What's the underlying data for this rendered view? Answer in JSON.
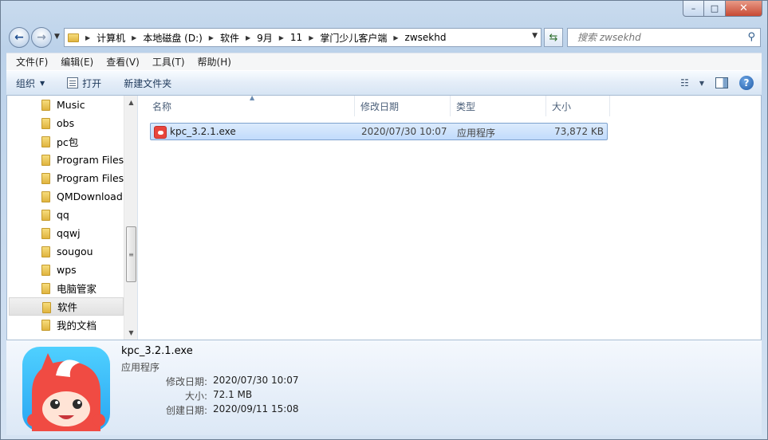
{
  "window_controls": {
    "minimize": "–",
    "maximize": "□",
    "close": "✕"
  },
  "nav": {
    "back_icon": "back-arrow-icon",
    "forward_icon": "forward-arrow-icon",
    "breadcrumbs": [
      "计算机",
      "本地磁盘 (D:)",
      "软件",
      "9月",
      "11",
      "掌门少儿客户端",
      "zwsekhd"
    ],
    "search_placeholder": "搜索 zwsekhd"
  },
  "menu": [
    "文件(F)",
    "编辑(E)",
    "查看(V)",
    "工具(T)",
    "帮助(H)"
  ],
  "toolbar": {
    "organize": "组织",
    "open": "打开",
    "new_folder": "新建文件夹"
  },
  "tree": {
    "items": [
      "Music",
      "obs",
      "pc包",
      "Program Files",
      "Program Files",
      "QMDownload",
      "qq",
      "qqwj",
      "sougou",
      "wps",
      "电脑管家",
      "软件",
      "我的文档"
    ],
    "selected_index": 11
  },
  "columns": {
    "name": "名称",
    "modified": "修改日期",
    "type": "类型",
    "size": "大小"
  },
  "files": [
    {
      "name": "kpc_3.2.1.exe",
      "modified": "2020/07/30 10:07",
      "type": "应用程序",
      "size": "73,872 KB"
    }
  ],
  "details": {
    "name": "kpc_3.2.1.exe",
    "type": "应用程序",
    "modified_label": "修改日期:",
    "modified_value": "2020/07/30 10:07",
    "size_label": "大小:",
    "size_value": "72.1 MB",
    "created_label": "创建日期:",
    "created_value": "2020/09/11 15:08"
  },
  "colors": {
    "selection": "#c1dbfc",
    "accent": "#e8453c",
    "toolbar_text": "#1e395b"
  }
}
